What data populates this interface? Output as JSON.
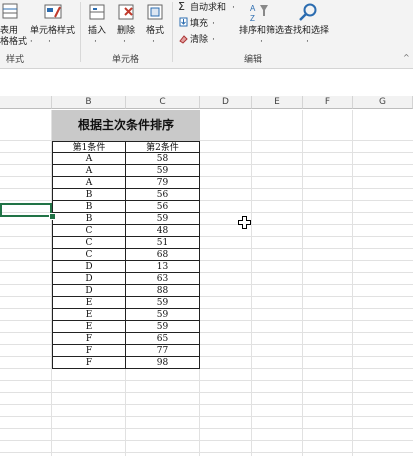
{
  "ribbon": {
    "cell_styles": {
      "line1": "表用",
      "line2": "格格式 ·",
      "group": "样式"
    },
    "cell_style_btn": "单元格样式",
    "insert": "插入",
    "delete": "删除",
    "format": "格式",
    "cells_group": "单元格",
    "autosum": "自动求和",
    "fill": "填充",
    "clear": "清除",
    "sort_filter": "排序和筛选",
    "find_select": "查找和选择",
    "editing_group": "编辑"
  },
  "columns": [
    "B",
    "C",
    "D",
    "E",
    "F",
    "G"
  ],
  "table": {
    "title": "根据主次条件排序",
    "headers": [
      "第1条件",
      "第2条件"
    ],
    "rows": [
      [
        "A",
        "58"
      ],
      [
        "A",
        "59"
      ],
      [
        "A",
        "79"
      ],
      [
        "B",
        "56"
      ],
      [
        "B",
        "56"
      ],
      [
        "B",
        "59"
      ],
      [
        "C",
        "48"
      ],
      [
        "C",
        "51"
      ],
      [
        "C",
        "68"
      ],
      [
        "D",
        "13"
      ],
      [
        "D",
        "63"
      ],
      [
        "D",
        "88"
      ],
      [
        "E",
        "59"
      ],
      [
        "E",
        "59"
      ],
      [
        "E",
        "59"
      ],
      [
        "F",
        "65"
      ],
      [
        "F",
        "77"
      ],
      [
        "F",
        "98"
      ]
    ]
  },
  "colors": {
    "accent": "#217346",
    "title_bg": "#c9c9c9"
  }
}
